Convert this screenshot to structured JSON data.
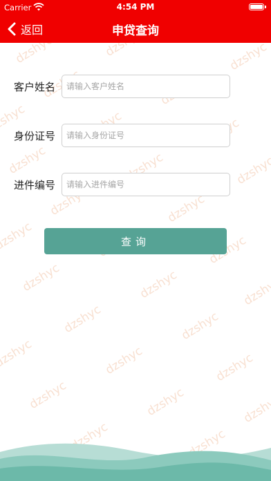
{
  "status_bar": {
    "carrier": "Carrier",
    "time": "4:54 PM"
  },
  "nav": {
    "back_label": "返回",
    "title": "申贷查询"
  },
  "form": {
    "fields": [
      {
        "label": "客户姓名",
        "placeholder": "请输入客户姓名",
        "value": ""
      },
      {
        "label": "身份证号",
        "placeholder": "请输入身份证号",
        "value": ""
      },
      {
        "label": "进件编号",
        "placeholder": "请输入进件编号",
        "value": ""
      }
    ],
    "submit_label": "查询"
  },
  "watermark_text": "dzshyc",
  "colors": {
    "header": "#f00000",
    "button": "#56a395",
    "wave": "#7fc2b4"
  }
}
